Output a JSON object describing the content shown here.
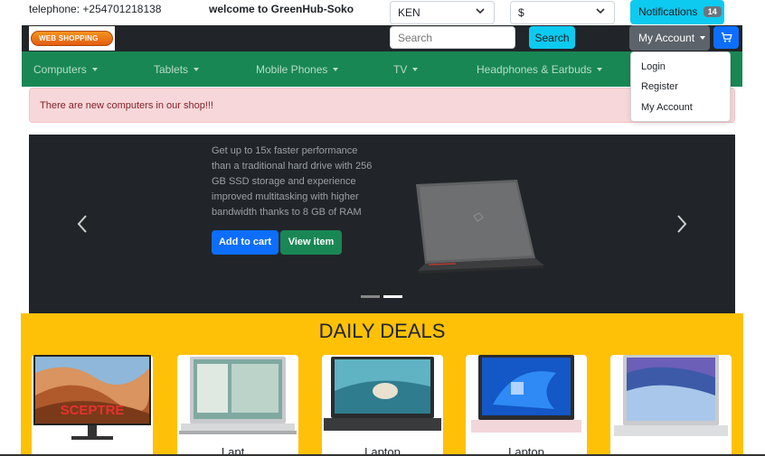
{
  "topbar": {
    "telephone": "telephone: +254701218138",
    "welcome": "welcome to GreenHub-Soko",
    "country_select": "KEN",
    "currency_select": "$",
    "notifications_label": "Notifications",
    "notifications_count": "14"
  },
  "header": {
    "logo_text": "WEB SHOPPING",
    "search_placeholder": "Search",
    "search_button": "Search",
    "account_button": "My Account"
  },
  "nav": {
    "items": [
      {
        "label": "Computers"
      },
      {
        "label": "Tablets"
      },
      {
        "label": "Mobile Phones"
      },
      {
        "label": "TV"
      },
      {
        "label": "Headphones & Earbuds"
      }
    ]
  },
  "account_menu": {
    "items": [
      {
        "label": "Login"
      },
      {
        "label": "Register"
      },
      {
        "label": "My Account"
      }
    ]
  },
  "alert": {
    "text": "There are new computers in our shop!!!"
  },
  "carousel": {
    "description": "Get up to 15x faster performance than a traditional hard drive with 256 GB SSD storage and experience improved multitasking with higher bandwidth thanks to 8 GB of RAM",
    "add_to_cart": "Add to cart",
    "view_item": "View item"
  },
  "deals": {
    "title": "DAILY DEALS",
    "cards": [
      {
        "brand_text": "SCEPTRE",
        "title": ""
      },
      {
        "title": "Lapt..."
      },
      {
        "title": "Laptop"
      },
      {
        "title": "Laptop"
      },
      {
        "title": ""
      }
    ]
  },
  "colors": {
    "dark": "#212529",
    "green": "#198754",
    "cyan": "#0dcaf0",
    "blue": "#0d6efd",
    "yellow": "#ffc107",
    "alert_bg": "#f8d7da"
  }
}
